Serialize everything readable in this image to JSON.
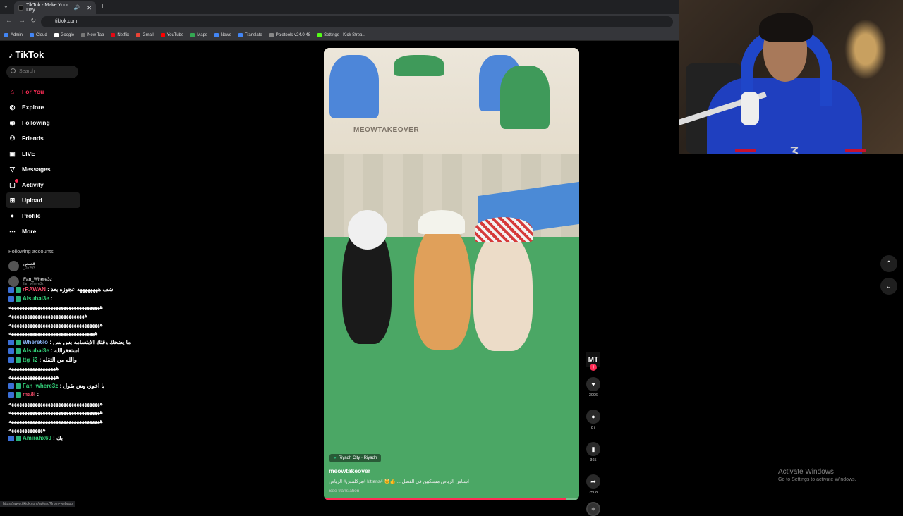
{
  "browser": {
    "tab_title": "TikTok - Make Your Day",
    "url": "tiktok.com",
    "bookmarks": [
      "Admin",
      "Cloud",
      "Google",
      "New Tab",
      "Netflix",
      "Gmail",
      "YouTube",
      "Maps",
      "News",
      "Translate",
      "Paletools v24.0.48",
      "Settings - Kick Strea..."
    ],
    "bookmark_colors": [
      "#4285f4",
      "#4285f4",
      "#fff",
      "#777",
      "#e50914",
      "#ea4335",
      "#ff0000",
      "#34a853",
      "#4285f4",
      "#4285f4",
      "#888",
      "#53fc18"
    ]
  },
  "tiktok": {
    "logo": "TikTok",
    "search_placeholder": "Search",
    "nav": [
      {
        "label": "For You",
        "icon": "home-icon"
      },
      {
        "label": "Explore",
        "icon": "compass-icon"
      },
      {
        "label": "Following",
        "icon": "following-icon"
      },
      {
        "label": "Friends",
        "icon": "friends-icon"
      },
      {
        "label": "LIVE",
        "icon": "live-icon"
      },
      {
        "label": "Messages",
        "icon": "messages-icon"
      },
      {
        "label": "Activity",
        "icon": "activity-icon"
      },
      {
        "label": "Upload",
        "icon": "upload-icon"
      },
      {
        "label": "Profile",
        "icon": "profile-icon"
      },
      {
        "label": "More",
        "icon": "more-icon"
      }
    ],
    "following_accounts_title": "Following accounts",
    "following_accounts": [
      {
        "name": "قصص",
        "handle": "_2e293"
      },
      {
        "name": "Fan_Where3z",
        "handle": "fan_where3z"
      }
    ]
  },
  "chat": [
    {
      "user": "rRAWAN",
      "user_color": "pink",
      "msg": ": شف ههههههههه عجوزه بعد"
    },
    {
      "user": "Alsubai3e",
      "user_color": "green",
      "msg": ":"
    },
    {
      "user": "",
      "user_color": "",
      "msg": "هههههههههههههههههههههههههههههههههههه"
    },
    {
      "user": "",
      "user_color": "",
      "msg": "هههههههههههههههههههههههههههههه"
    },
    {
      "user": "",
      "user_color": "",
      "msg": "هههههههههههههههههههههههههههههههههههه"
    },
    {
      "user": "",
      "user_color": "",
      "msg": "هههههههههههههههههههههههههههههههههه"
    },
    {
      "user": "Where6lo",
      "user_color": "blue",
      "msg": ": ما يضحك وقتك الابتسامه بس بس"
    },
    {
      "user": "Alsubai3e",
      "user_color": "green",
      "msg": ": استغفرالله"
    },
    {
      "user": "ttg_i2",
      "user_color": "green",
      "msg": ": والله من التقله"
    },
    {
      "user": "",
      "user_color": "",
      "msg": "ههههههههههههههههههه"
    },
    {
      "user": "",
      "user_color": "",
      "msg": "ههههههههههههههههههه"
    },
    {
      "user": "Fan_where3z",
      "user_color": "green",
      "msg": ": يا اخوي وش يقول"
    },
    {
      "user": "ma8i",
      "user_color": "pink",
      "msg": ":"
    },
    {
      "user": "",
      "user_color": "",
      "msg": "هههههههههههههههههههههههههههههههههههه"
    },
    {
      "user": "",
      "user_color": "",
      "msg": "هههههههههههههههههههههههههههههههههههه"
    },
    {
      "user": "",
      "user_color": "",
      "msg": "هههههههههههههههههههههههههههههههههههه"
    },
    {
      "user": "",
      "user_color": "",
      "msg": "هههههههههههههه"
    },
    {
      "user": "Amirahx69",
      "user_color": "green",
      "msg": ": بك"
    }
  ],
  "video": {
    "watermark": "MEOWTAKEOVER",
    "location": "Riyadh City · Riyadh",
    "author": "meowtakeover",
    "caption": "مركلمس# الرياض# kittens# 🐱👍 ... اسباس الرياض مستكبين في الفصل",
    "see_translation": "See translation",
    "progress_percent": 95
  },
  "actions": {
    "creator_initials": "MT",
    "likes": "3096",
    "comments": "87",
    "saves": "365",
    "shares": "2508"
  },
  "windows": {
    "activate_title": "Activate Windows",
    "activate_sub": "Go to Settings to activate Windows."
  },
  "status_url": "https://www.tiktok.com/upload?from=webapp",
  "colors": {
    "accent": "#fe2c55",
    "background": "#000000"
  }
}
